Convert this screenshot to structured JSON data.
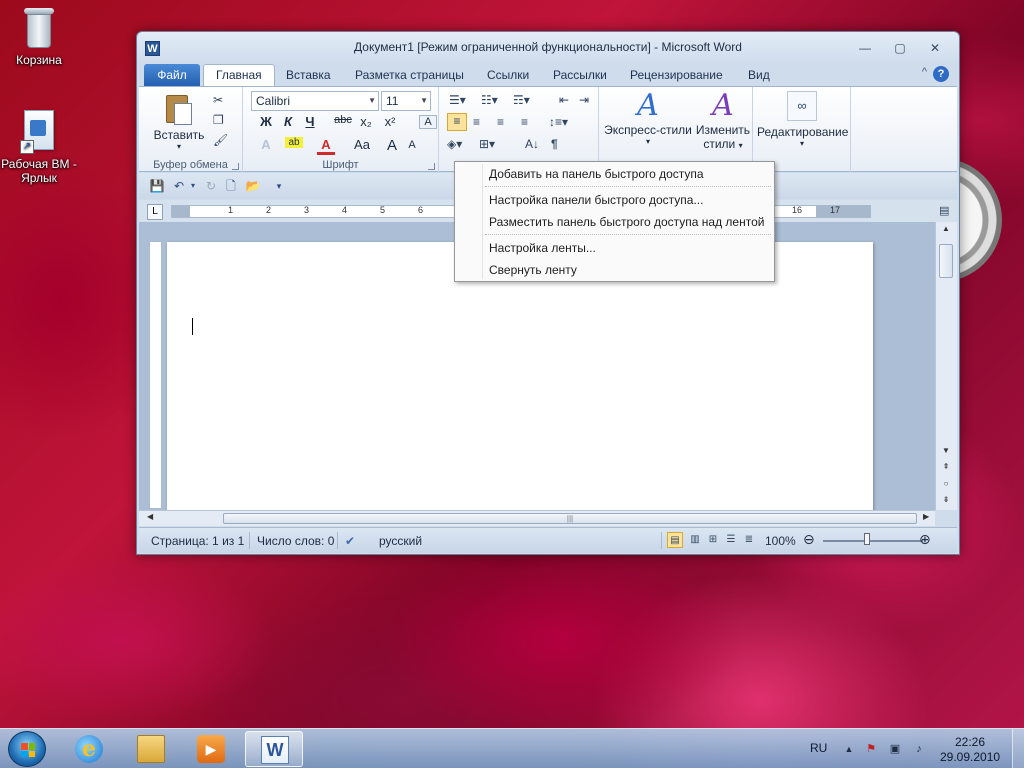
{
  "desktop": {
    "icons": [
      {
        "label": "Корзина",
        "icon": "recycle-bin-icon"
      },
      {
        "label": "Рабочая ВМ - Ярлык",
        "icon": "shortcut-icon"
      }
    ]
  },
  "window": {
    "title": "Документ1 [Режим ограниченной функциональности] - Microsoft Word",
    "app_icon_letter": "W",
    "controls": {
      "minimize": "▭",
      "maximize": "▢",
      "close": "✕"
    }
  },
  "tabs": {
    "file": "Файл",
    "items": [
      "Главная",
      "Вставка",
      "Разметка страницы",
      "Ссылки",
      "Рассылки",
      "Рецензирование",
      "Вид"
    ],
    "active_index": 0,
    "collapse_icon": "^",
    "help_icon": "?"
  },
  "ribbon": {
    "clipboard": {
      "paste_label": "Вставить",
      "group_label": "Буфер обмена"
    },
    "font": {
      "font_name": "Calibri",
      "font_size": "11",
      "bold": "Ж",
      "italic": "К",
      "underline": "Ч",
      "strike": "abc",
      "subscript": "x₂",
      "superscript": "x²",
      "grow": "A",
      "shrink": "A",
      "case": "Aa",
      "group_label": "Шрифт"
    },
    "paragraph": {
      "pilcrow": "¶"
    },
    "styles": {
      "express_label": "Экспресс-стили",
      "change_label_1": "Изменить",
      "change_label_2": "стили"
    },
    "editing": {
      "label": "Редактирование"
    }
  },
  "context_menu": {
    "items": [
      "Добавить на панель быстрого доступа",
      "Настройка панели быстрого доступа...",
      "Разместить панель быстрого доступа над лентой",
      "Настройка ленты...",
      "Свернуть ленту"
    ]
  },
  "ruler": {
    "numbers": [
      "1",
      "2",
      "3",
      "4",
      "5",
      "6",
      "16",
      "17"
    ]
  },
  "status_bar": {
    "page": "Страница: 1 из 1",
    "words": "Число слов: 0",
    "language": "русский",
    "zoom": "100%",
    "zoom_level": 1.0
  },
  "taskbar": {
    "language": "RU",
    "time": "22:26",
    "date": "29.09.2010",
    "apps": [
      "internet-explorer",
      "windows-explorer",
      "media-player",
      "microsoft-word"
    ],
    "active_app": "microsoft-word"
  },
  "colors": {
    "file_tab": "#2a66b8",
    "active_align": "#fbe39c"
  }
}
